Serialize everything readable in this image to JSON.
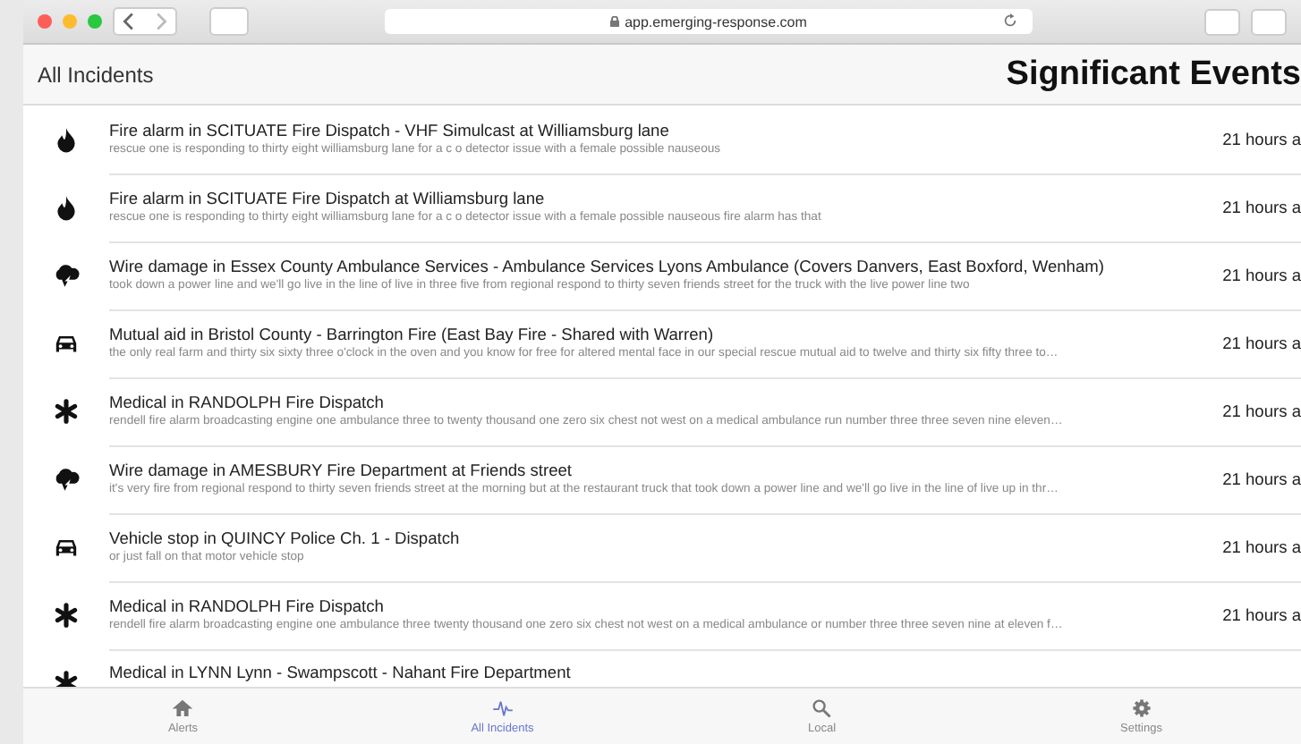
{
  "browser": {
    "address": "app.emerging-response.com"
  },
  "header": {
    "title": "All Incidents",
    "heading": "Significant Events"
  },
  "incidents": [
    {
      "kind": "fire",
      "title": "Fire alarm in SCITUATE Fire Dispatch - VHF Simulcast at Williamsburg lane",
      "summary": "rescue one is responding to thirty eight williamsburg lane for a c o detector issue with a female possible nauseous",
      "time": "21 hours a"
    },
    {
      "kind": "fire",
      "title": "Fire alarm in SCITUATE Fire Dispatch at Williamsburg lane",
      "summary": "rescue one is responding to thirty eight williamsburg lane for a c o detector issue with a female possible nauseous fire alarm has that",
      "time": "21 hours a"
    },
    {
      "kind": "wire",
      "title": "Wire damage in Essex County Ambulance Services - Ambulance Services Lyons Ambulance (Covers Danvers, East Boxford, Wenham)",
      "summary": "took down a power line and we'll go live in the line of live in three five from regional respond to thirty seven friends street for the truck with the live power line two",
      "time": "21 hours a"
    },
    {
      "kind": "vehicle",
      "title": "Mutual aid in Bristol County - Barrington Fire (East Bay Fire - Shared with Warren)",
      "summary": "the only real farm and thirty six sixty three o'clock in the oven and you know for free for altered mental face in our special rescue mutual aid to twelve and thirty six fifty three to…",
      "time": "21 hours a"
    },
    {
      "kind": "medical",
      "title": "Medical in RANDOLPH Fire Dispatch",
      "summary": "rendell fire alarm broadcasting engine one ambulance three to twenty thousand one zero six chest not west on a medical ambulance run number three three seven nine eleven…",
      "time": "21 hours a"
    },
    {
      "kind": "wire",
      "title": "Wire damage in AMESBURY Fire Department at Friends street",
      "summary": "it's very fire from regional respond to thirty seven friends street at the morning but at the restaurant truck that took down a power line and we'll go live in the line of live up in thr…",
      "time": "21 hours a"
    },
    {
      "kind": "vehicle",
      "title": "Vehicle stop in QUINCY Police Ch. 1 - Dispatch",
      "summary": "or just fall on that motor vehicle stop",
      "time": "21 hours a"
    },
    {
      "kind": "medical",
      "title": "Medical in RANDOLPH Fire Dispatch",
      "summary": "rendell fire alarm broadcasting engine one ambulance three twenty thousand one zero six chest not west on a medical ambulance or number three three seven nine at eleven f…",
      "time": "21 hours a"
    },
    {
      "kind": "medical",
      "title": "Medical in LYNN Lynn - Swampscott - Nahant Fire Department"
    }
  ],
  "tabs": [
    {
      "kind": "home",
      "label": "Alerts",
      "selected": false
    },
    {
      "kind": "pulse",
      "label": "All Incidents",
      "selected": true
    },
    {
      "kind": "search",
      "label": "Local",
      "selected": false
    },
    {
      "kind": "gear",
      "label": "Settings",
      "selected": false
    }
  ]
}
